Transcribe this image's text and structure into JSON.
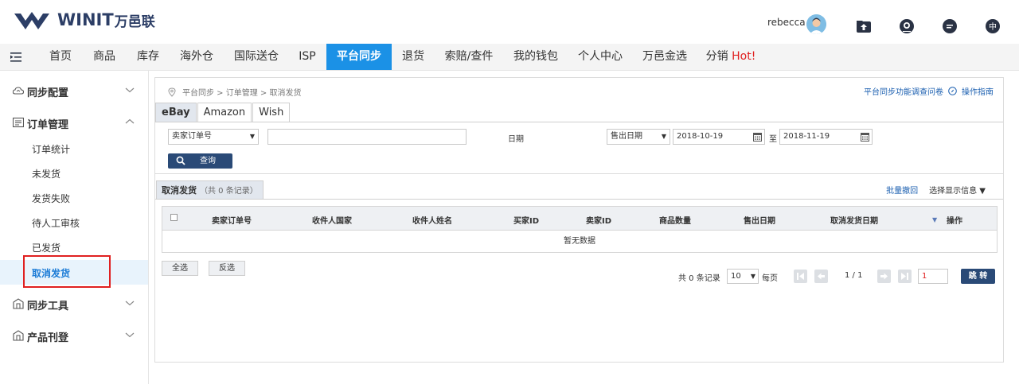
{
  "header": {
    "logo_text": "WINIT",
    "logo_cn": "万邑联",
    "username": "rebecca"
  },
  "topnav": {
    "items": [
      {
        "label": "首页"
      },
      {
        "label": "商品"
      },
      {
        "label": "库存"
      },
      {
        "label": "海外仓"
      },
      {
        "label": "国际送仓"
      },
      {
        "label": "ISP"
      },
      {
        "label": "平台同步",
        "active": true
      },
      {
        "label": "退货"
      },
      {
        "label": "索赔/查件"
      },
      {
        "label": "我的钱包"
      },
      {
        "label": "个人中心"
      },
      {
        "label": "万邑金选"
      },
      {
        "label": "分销",
        "hot": "Hot!"
      }
    ]
  },
  "sidebar": {
    "groups": [
      {
        "label": "同步配置",
        "icon": "cloud-sync-icon",
        "expanded": false
      },
      {
        "label": "订单管理",
        "icon": "list-icon",
        "expanded": true
      },
      {
        "label": "同步工具",
        "icon": "tool-icon",
        "expanded": false
      },
      {
        "label": "产品刊登",
        "icon": "publish-icon",
        "expanded": false
      }
    ],
    "order_items": [
      {
        "label": "订单统计"
      },
      {
        "label": "未发货"
      },
      {
        "label": "发货失败"
      },
      {
        "label": "待人工审核"
      },
      {
        "label": "已发货"
      },
      {
        "label": "取消发货",
        "active": true
      }
    ]
  },
  "breadcrumb": {
    "text": "平台同步 > 订单管理 > 取消发货",
    "survey": "平台同步功能调查问卷",
    "guide": "操作指南"
  },
  "tabs": [
    {
      "label": "eBay",
      "active": true
    },
    {
      "label": "Amazon"
    },
    {
      "label": "Wish"
    }
  ],
  "filters": {
    "order_type": "卖家订单号",
    "order_value": "",
    "date_label": "日期",
    "date_type": "售出日期",
    "date_from": "2018-10-19",
    "date_sep": "至",
    "date_to": "2018-11-19",
    "search_label": "查询"
  },
  "list": {
    "title": "取消发货",
    "count": "（共 0 条记录）",
    "bulk_revoke": "批量撤回",
    "choose_columns": "选择显示信息 ▼"
  },
  "table": {
    "columns": [
      "卖家订单号",
      "收件人国家",
      "收件人姓名",
      "买家ID",
      "卖家ID",
      "商品数量",
      "售出日期",
      "取消发货日期",
      "操作"
    ],
    "empty": "暂无数据"
  },
  "actions": {
    "select_all": "全选",
    "invert": "反选"
  },
  "pager": {
    "total": "共 0 条记录",
    "page_size": "10",
    "per_page": "每页",
    "page_info": "1 / 1",
    "page_input": "1",
    "go": "跳 转"
  },
  "colors": {
    "accent": "#1b91e6",
    "navy": "#2a4a77",
    "highlight_red": "#e02020"
  }
}
